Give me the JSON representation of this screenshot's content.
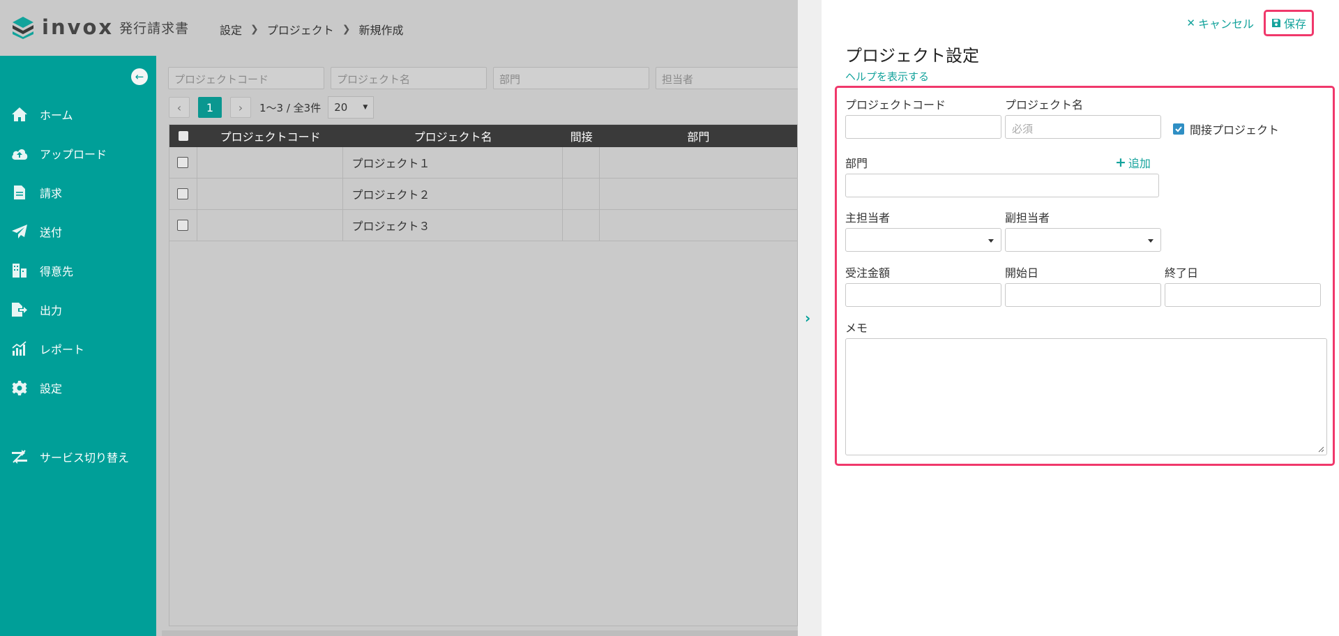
{
  "header": {
    "logo_text": "invox",
    "logo_sub": "発行請求書",
    "breadcrumb": [
      "設定",
      "プロジェクト",
      "新規作成"
    ]
  },
  "sidebar": {
    "collapse_icon": "arrow-left-circle-icon",
    "items": [
      {
        "label": "ホーム",
        "icon": "home-icon"
      },
      {
        "label": "アップロード",
        "icon": "cloud-upload-icon"
      },
      {
        "label": "請求",
        "icon": "document-icon"
      },
      {
        "label": "送付",
        "icon": "paper-plane-icon"
      },
      {
        "label": "得意先",
        "icon": "building-icon"
      },
      {
        "label": "出力",
        "icon": "file-export-icon"
      },
      {
        "label": "レポート",
        "icon": "chart-icon"
      },
      {
        "label": "設定",
        "icon": "gear-icon"
      }
    ],
    "service_switch": {
      "label": "サービス切り替え",
      "icon": "switch-icon"
    }
  },
  "filters": {
    "project_code_placeholder": "プロジェクトコード",
    "project_name_placeholder": "プロジェクト名",
    "department_placeholder": "部門",
    "person_placeholder": "担当者"
  },
  "pager": {
    "current_page": "1",
    "info": "1〜3 / 全3件",
    "page_size": "20"
  },
  "table": {
    "columns": [
      "プロジェクトコード",
      "プロジェクト名",
      "間接",
      "部門"
    ],
    "rows": [
      {
        "code": "",
        "name": "プロジェクト１",
        "indirect": "",
        "department": ""
      },
      {
        "code": "",
        "name": "プロジェクト２",
        "indirect": "",
        "department": ""
      },
      {
        "code": "",
        "name": "プロジェクト３",
        "indirect": "",
        "department": ""
      }
    ]
  },
  "panel": {
    "cancel_label": "キャンセル",
    "save_label": "保存",
    "title": "プロジェクト設定",
    "help_link": "ヘルプを表示する",
    "form": {
      "project_code_label": "プロジェクトコード",
      "project_code_value": "",
      "project_name_label": "プロジェクト名",
      "project_name_placeholder": "必須",
      "indirect_label": "間接プロジェクト",
      "indirect_checked": true,
      "department_label": "部門",
      "add_label": "追加",
      "main_person_label": "主担当者",
      "sub_person_label": "副担当者",
      "order_amount_label": "受注金額",
      "start_date_label": "開始日",
      "end_date_label": "終了日",
      "memo_label": "メモ"
    }
  },
  "colors": {
    "brand": "#009f98",
    "accent_text": "#14a39c",
    "highlight": "#f0386b",
    "table_header": "#3a3a3a",
    "checkbox": "#2f8fc4"
  }
}
